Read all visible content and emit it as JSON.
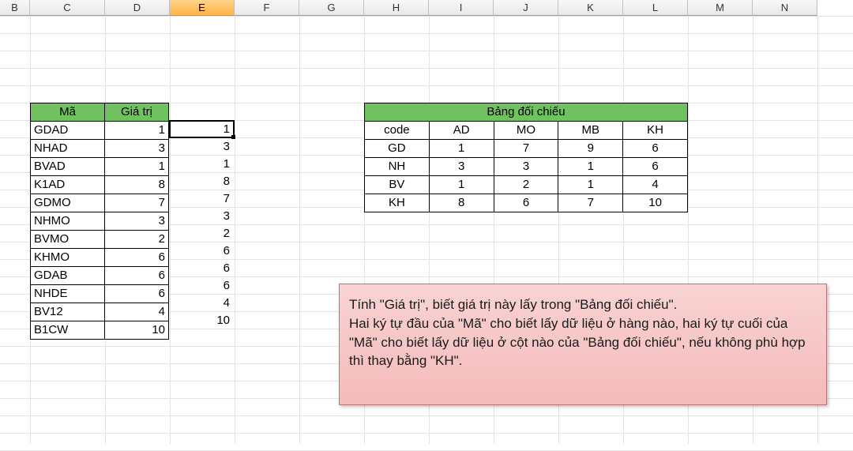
{
  "columns": [
    {
      "label": "B",
      "width": 38,
      "selected": false
    },
    {
      "label": "C",
      "width": 95,
      "selected": false
    },
    {
      "label": "D",
      "width": 82,
      "selected": false
    },
    {
      "label": "E",
      "width": 82,
      "selected": true
    },
    {
      "label": "F",
      "width": 82,
      "selected": false
    },
    {
      "label": "G",
      "width": 82,
      "selected": false
    },
    {
      "label": "H",
      "width": 82,
      "selected": false
    },
    {
      "label": "I",
      "width": 82,
      "selected": false
    },
    {
      "label": "J",
      "width": 82,
      "selected": false
    },
    {
      "label": "K",
      "width": 82,
      "selected": false
    },
    {
      "label": "L",
      "width": 82,
      "selected": false
    },
    {
      "label": "M",
      "width": 82,
      "selected": false
    },
    {
      "label": "N",
      "width": 82,
      "selected": false
    }
  ],
  "table1": {
    "headers": [
      "Mã",
      "Giá trị"
    ],
    "rows": [
      {
        "ma": "GDAD",
        "giatri": "1",
        "extra": "1"
      },
      {
        "ma": "NHAD",
        "giatri": "3",
        "extra": "3"
      },
      {
        "ma": "BVAD",
        "giatri": "1",
        "extra": "1"
      },
      {
        "ma": "K1AD",
        "giatri": "8",
        "extra": "8"
      },
      {
        "ma": "GDMO",
        "giatri": "7",
        "extra": "7"
      },
      {
        "ma": "NHMO",
        "giatri": "3",
        "extra": "3"
      },
      {
        "ma": "BVMO",
        "giatri": "2",
        "extra": "2"
      },
      {
        "ma": "KHMO",
        "giatri": "6",
        "extra": "6"
      },
      {
        "ma": "GDAB",
        "giatri": "6",
        "extra": "6"
      },
      {
        "ma": "NHDE",
        "giatri": "6",
        "extra": "6"
      },
      {
        "ma": "BV12",
        "giatri": "4",
        "extra": "4"
      },
      {
        "ma": "B1CW",
        "giatri": "10",
        "extra": "10"
      }
    ]
  },
  "table2": {
    "title": "Bảng đối chiếu",
    "headers": [
      "code",
      "AD",
      "MO",
      "MB",
      "KH"
    ],
    "rows": [
      [
        "GD",
        "1",
        "7",
        "9",
        "6"
      ],
      [
        "NH",
        "3",
        "3",
        "1",
        "6"
      ],
      [
        "BV",
        "1",
        "2",
        "1",
        "4"
      ],
      [
        "KH",
        "8",
        "6",
        "7",
        "10"
      ]
    ]
  },
  "callout": {
    "line1": "Tính \"Giá trị\", biết giá trị này lấy trong \"Bảng đối chiếu\".",
    "line2": " Hai ký tự đầu của \"Mã\" cho biết lấy dữ liệu ở hàng nào, hai ký tự cuối của \"Mã\" cho biết lấy dữ liệu ở cột nào của \"Bảng đối chiếu\", nếu không phù hợp thì thay bằng \"KH\"."
  },
  "chart_data": {
    "type": "table",
    "tables": [
      {
        "name": "Mã / Giá trị",
        "columns": [
          "Mã",
          "Giá trị"
        ],
        "rows": [
          [
            "GDAD",
            1
          ],
          [
            "NHAD",
            3
          ],
          [
            "BVAD",
            1
          ],
          [
            "K1AD",
            8
          ],
          [
            "GDMO",
            7
          ],
          [
            "NHMO",
            3
          ],
          [
            "BVMO",
            2
          ],
          [
            "KHMO",
            6
          ],
          [
            "GDAB",
            6
          ],
          [
            "NHDE",
            6
          ],
          [
            "BV12",
            4
          ],
          [
            "B1CW",
            10
          ]
        ]
      },
      {
        "name": "Bảng đối chiếu",
        "columns": [
          "code",
          "AD",
          "MO",
          "MB",
          "KH"
        ],
        "rows": [
          [
            "GD",
            1,
            7,
            9,
            6
          ],
          [
            "NH",
            3,
            3,
            1,
            6
          ],
          [
            "BV",
            1,
            2,
            1,
            4
          ],
          [
            "KH",
            8,
            6,
            7,
            10
          ]
        ]
      }
    ]
  }
}
